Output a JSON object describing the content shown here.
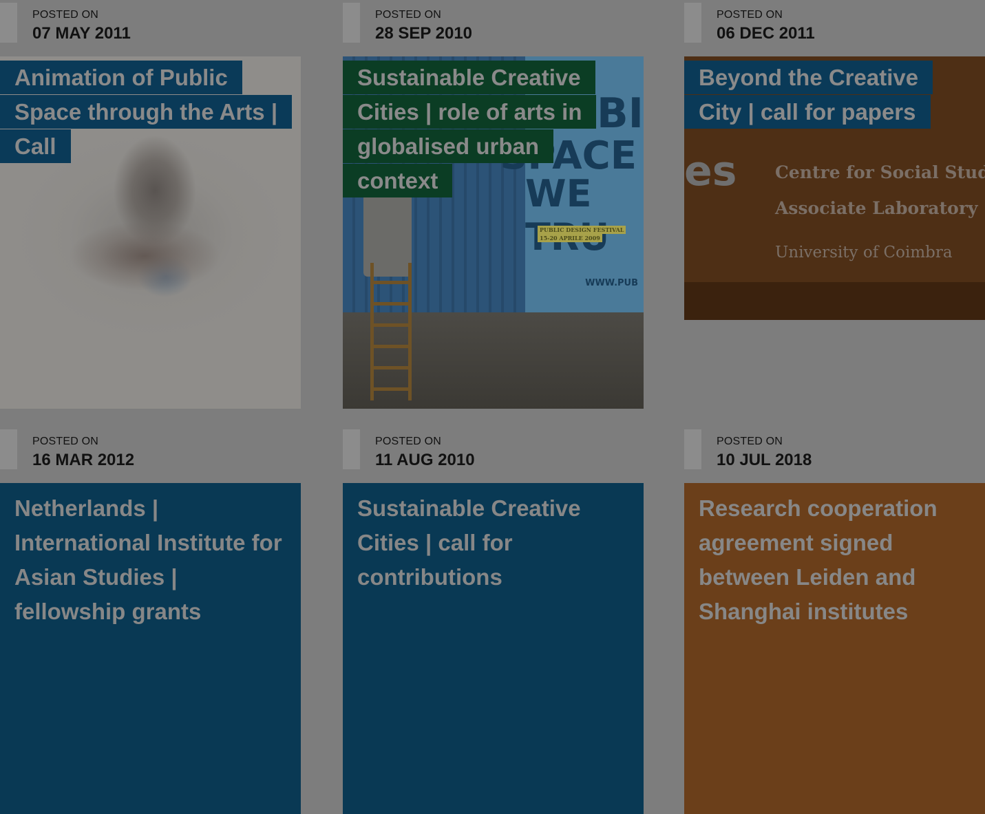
{
  "posted_label": "POSTED ON",
  "posts": [
    {
      "date": "07 MAY 2011",
      "title_lines": [
        "Animation of Public",
        "Space through the Arts |",
        "Call"
      ],
      "title_bg": "#0a3a58",
      "image": "blurry-stones-photo"
    },
    {
      "date": "28 SEP 2010",
      "title_lines": [
        "Sustainable Creative",
        "Cities | role of arts in",
        "globalised urban",
        "context"
      ],
      "title_bg": "#0b3d24",
      "image": "container-painting-photo",
      "image_text": {
        "poster_big1": "UBI",
        "poster_big2": "SPACE",
        "poster_big3": "WE TRU",
        "poster_small1": "PUBLIC DESIGN FESTIVAL",
        "poster_small2": "15-20 APRILE 2009",
        "poster_url": "WWW.PUB"
      }
    },
    {
      "date": "06 DEC 2011",
      "title_lines": [
        "Beyond the Creative",
        "City | call for papers"
      ],
      "title_bg": "#0a3a58",
      "image": "ces-coimbra-banner",
      "image_text": {
        "logo": "es",
        "line1": "Centre for Social Studies",
        "line2": "Associate Laboratory",
        "line3": "University of Coimbra"
      }
    },
    {
      "date": "16 MAR 2012",
      "title": "Netherlands | International Institute for Asian Studies | fellowship grants",
      "card_bg": "#093954"
    },
    {
      "date": "11 AUG 2010",
      "title": "Sustainable Creative Cities | call for contributions",
      "card_bg": "#093954"
    },
    {
      "date": "10 JUL 2018",
      "title": "Research cooperation agreement signed between Leiden and Shanghai institutes",
      "card_bg": "#6b3f1a"
    }
  ]
}
